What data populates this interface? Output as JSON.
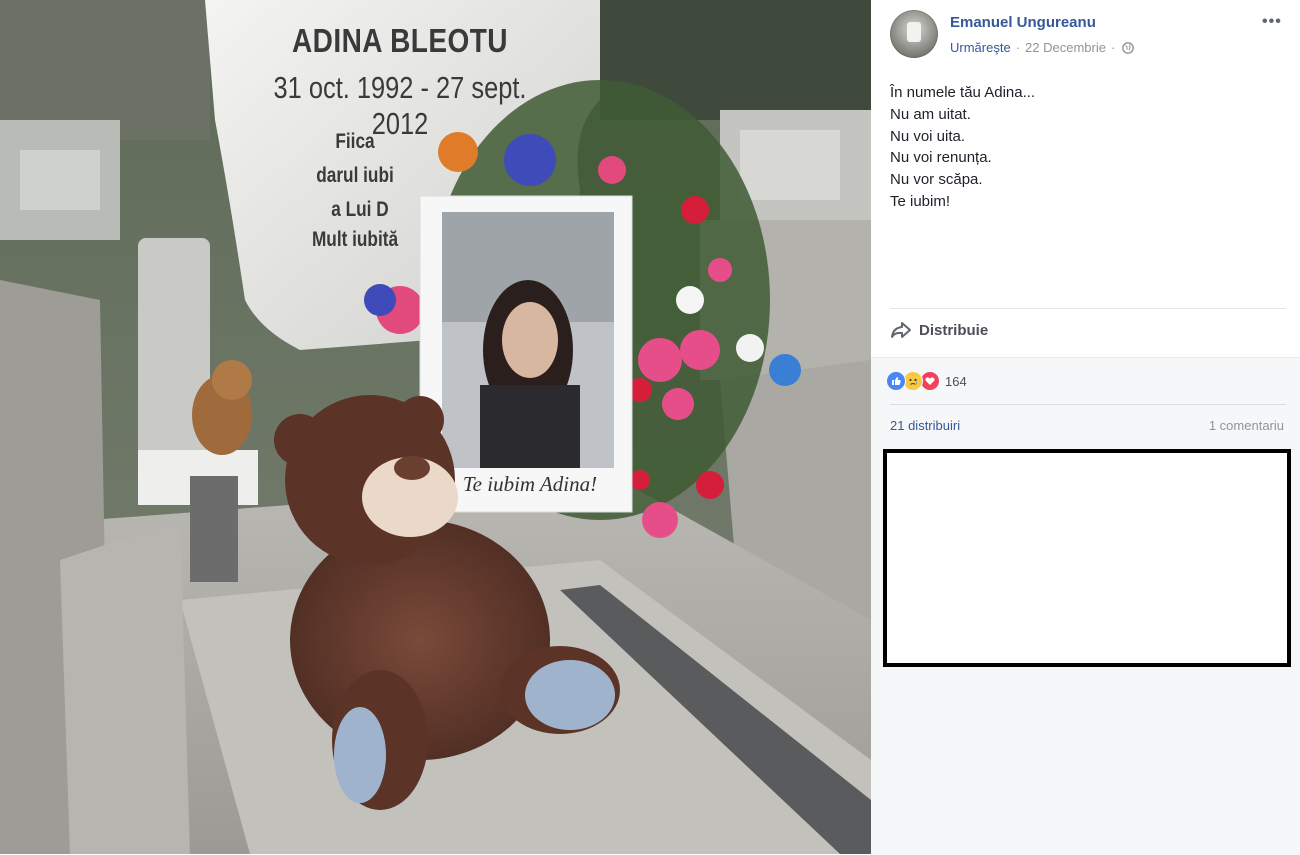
{
  "photo": {
    "headstone": {
      "name": "ADINA BLEOTU",
      "dates": "31 oct. 1992 - 27 sept. 2012",
      "lines": [
        "Fiica",
        "darul iubi",
        "a Lui D",
        "Mult iubită"
      ]
    },
    "portrait_caption": "Te iubim Adina!"
  },
  "post": {
    "author": "Emanuel Ungureanu",
    "follow_label": "Urmăreşte",
    "separator": "·",
    "date": "22 Decembrie",
    "privacy_icon": "globe-icon",
    "more_label": "•••",
    "text_lines": [
      "În numele tău Adina...",
      "Nu am uitat.",
      "Nu voi uita.",
      "Nu voi renunța.",
      "Nu vor scăpa.",
      "Te iubim!"
    ],
    "share_label": "Distribuie",
    "reactions": {
      "icons": [
        "like-icon",
        "sad-icon",
        "love-icon"
      ],
      "count": "164"
    },
    "shares_label": "21 distribuiri",
    "comments_label": "1 comentariu"
  },
  "colors": {
    "link": "#365899",
    "meta": "#90949c",
    "text": "#1d2129",
    "stats_bg": "#f6f7f9"
  }
}
